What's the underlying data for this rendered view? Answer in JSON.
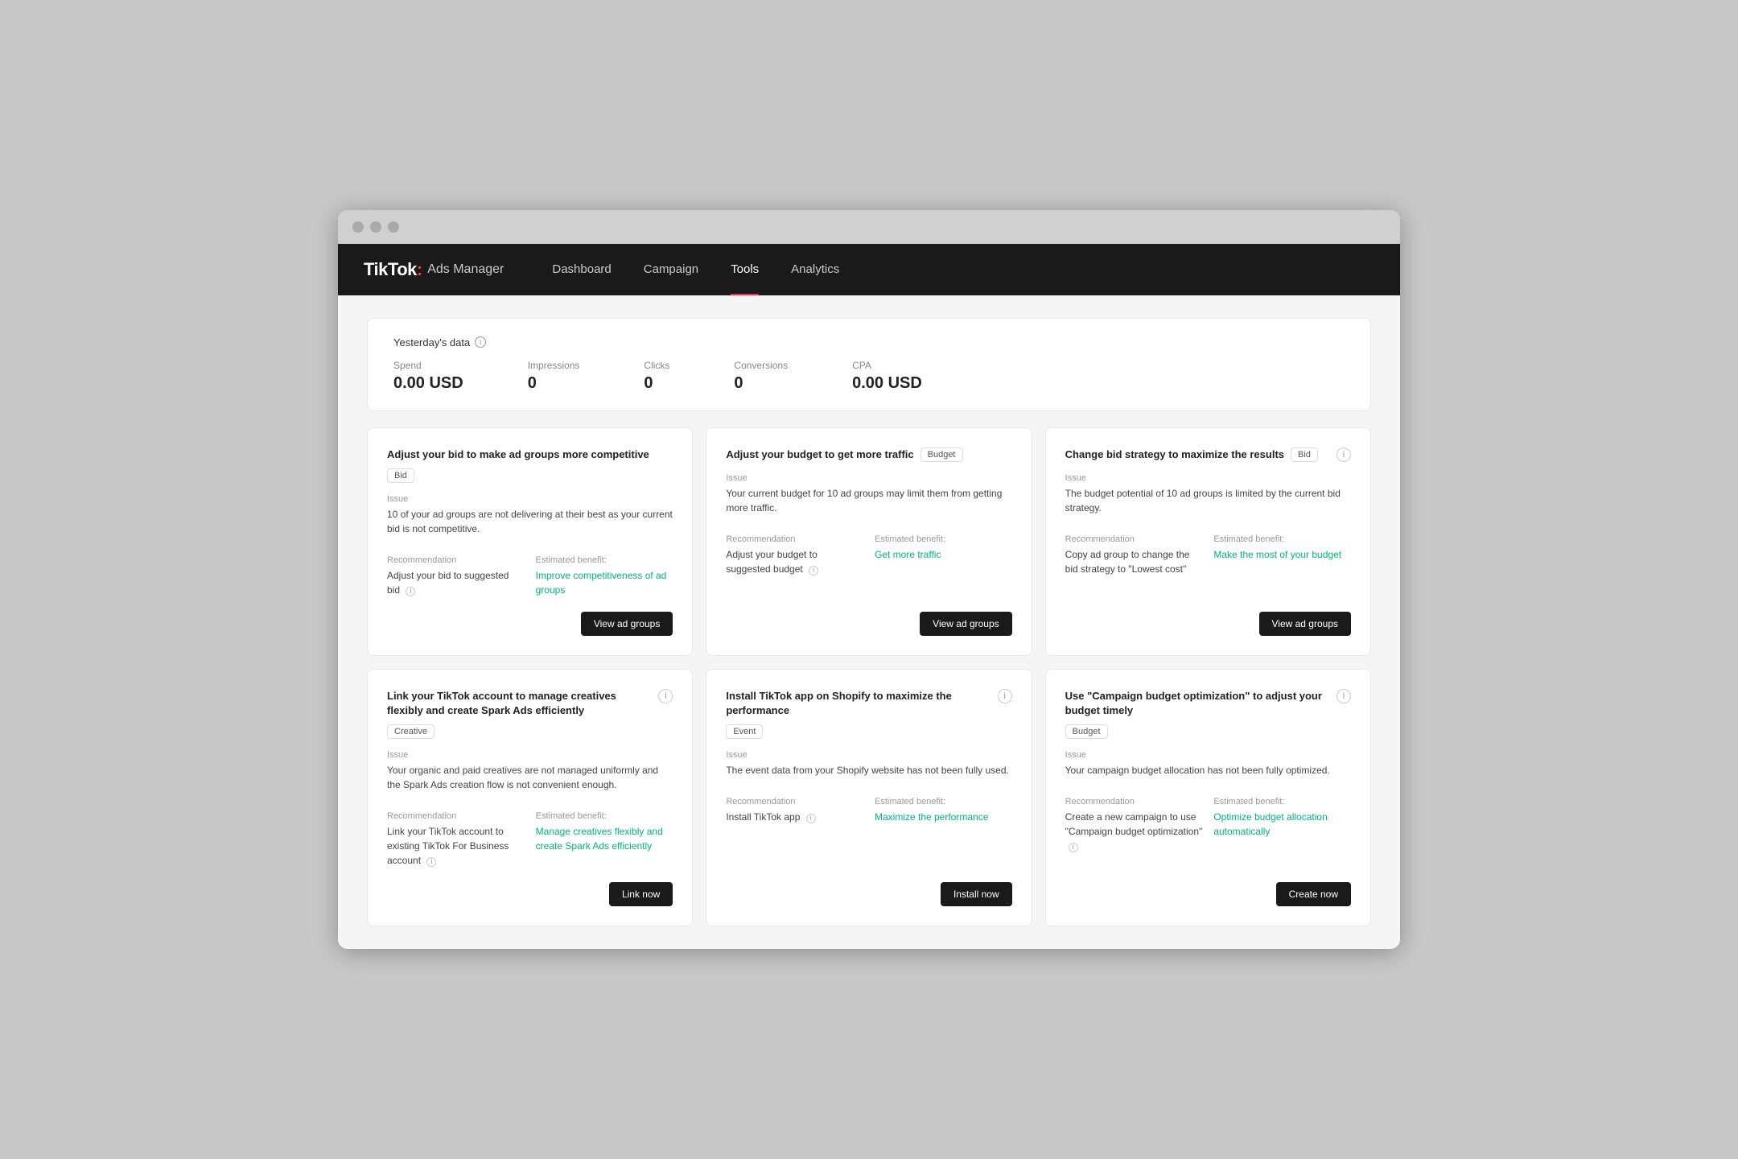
{
  "browser": {
    "title": "TikTok Ads Manager"
  },
  "nav": {
    "logo_tiktok": "TikTok",
    "logo_colon": ":",
    "logo_ads": "Ads Manager",
    "items": [
      {
        "label": "Dashboard",
        "active": false
      },
      {
        "label": "Campaign",
        "active": false
      },
      {
        "label": "Tools",
        "active": true
      },
      {
        "label": "Analytics",
        "active": false
      }
    ]
  },
  "stats": {
    "title": "Yesterday's data",
    "items": [
      {
        "label": "Spend",
        "value": "0.00 USD"
      },
      {
        "label": "Impressions",
        "value": "0"
      },
      {
        "label": "Clicks",
        "value": "0"
      },
      {
        "label": "Conversions",
        "value": "0"
      },
      {
        "label": "CPA",
        "value": "0.00 USD"
      }
    ]
  },
  "cards": [
    {
      "id": "card-bid",
      "title": "Adjust your bid to make ad groups more competitive",
      "tag": "Bid",
      "issue_label": "Issue",
      "issue_text": "10 of your ad groups are not delivering at their best as your current bid is not competitive.",
      "recommendation_label": "Recommendation",
      "recommendation_text": "Adjust your bid to suggested bid",
      "benefit_label": "Estimated benefit:",
      "benefit_text": "Improve competitiveness of ad groups",
      "button_label": "View ad groups",
      "has_info": false
    },
    {
      "id": "card-budget",
      "title": "Adjust your budget to get more traffic",
      "tag": "Budget",
      "issue_label": "Issue",
      "issue_text": "Your current budget for 10 ad groups may limit them from getting more traffic.",
      "recommendation_label": "Recommendation",
      "recommendation_text": "Adjust your budget to suggested budget",
      "benefit_label": "Estimated benefit:",
      "benefit_text": "Get more traffic",
      "button_label": "View ad groups",
      "has_info": false
    },
    {
      "id": "card-bid-strategy",
      "title": "Change bid strategy to maximize the results",
      "tag": "Bid",
      "issue_label": "Issue",
      "issue_text": "The budget potential of 10 ad groups is limited by the current bid strategy.",
      "recommendation_label": "Recommendation",
      "recommendation_text": "Copy ad group to change the bid strategy to \"Lowest cost\"",
      "benefit_label": "Estimated benefit:",
      "benefit_text": "Make the most of your budget",
      "button_label": "View ad groups",
      "has_info": true
    },
    {
      "id": "card-spark",
      "title": "Link your TikTok account to manage creatives flexibly and create Spark Ads efficiently",
      "tag": "Creative",
      "issue_label": "Issue",
      "issue_text": "Your organic and paid creatives are not managed uniformly and the Spark Ads creation flow is not convenient enough.",
      "recommendation_label": "Recommendation",
      "recommendation_text": "Link your TikTok account to existing TikTok For Business account",
      "benefit_label": "Estimated benefit:",
      "benefit_text": "Manage creatives flexibly and create Spark Ads efficiently",
      "button_label": "Link now",
      "has_info": true
    },
    {
      "id": "card-shopify",
      "title": "Install TikTok app on Shopify to maximize the performance",
      "tag": "Event",
      "issue_label": "Issue",
      "issue_text": "The event data from your Shopify website has not been fully used.",
      "recommendation_label": "Recommendation",
      "recommendation_text": "Install TikTok app",
      "benefit_label": "Estimated benefit:",
      "benefit_text": "Maximize the performance",
      "button_label": "Install now",
      "has_info": true
    },
    {
      "id": "card-cbo",
      "title": "Use \"Campaign budget optimization\" to adjust your budget timely",
      "tag": "Budget",
      "issue_label": "Issue",
      "issue_text": "Your campaign budget allocation has not been fully optimized.",
      "recommendation_label": "Recommendation",
      "recommendation_text": "Create a new campaign to use \"Campaign budget optimization\"",
      "benefit_label": "Estimated benefit:",
      "benefit_text": "Optimize budget allocation automatically",
      "button_label": "Create now",
      "has_info": true
    }
  ]
}
